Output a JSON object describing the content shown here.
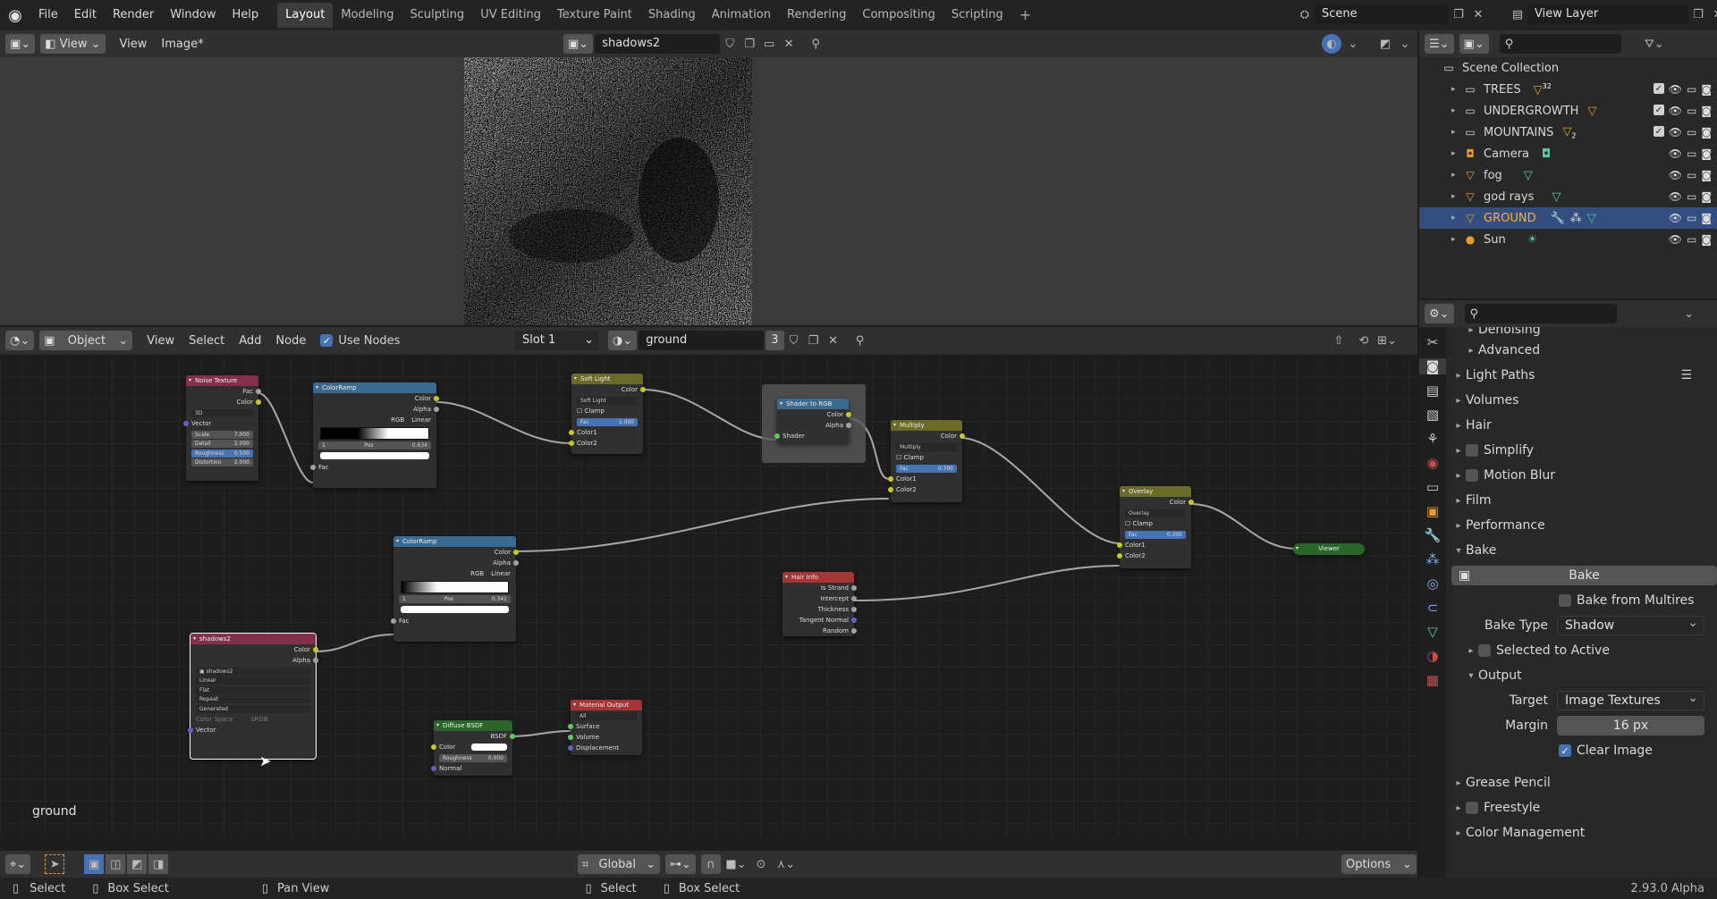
{
  "topbar": {
    "menus": [
      "File",
      "Edit",
      "Render",
      "Window",
      "Help"
    ],
    "workspaces": [
      "Layout",
      "Modeling",
      "Sculpting",
      "UV Editing",
      "Texture Paint",
      "Shading",
      "Animation",
      "Rendering",
      "Compositing",
      "Scripting"
    ],
    "active_workspace": "Layout",
    "scene": "Scene",
    "view_layer": "View Layer"
  },
  "image_editor": {
    "view_label": "View",
    "view_menu": "View",
    "image_menu": "Image*",
    "image_name": "shadows2"
  },
  "node_editor": {
    "object_mode": "Object",
    "menus": [
      "View",
      "Select",
      "Add",
      "Node"
    ],
    "use_nodes_label": "Use Nodes",
    "slot": "Slot 1",
    "material": "ground",
    "users": "3",
    "overlay_label": "ground",
    "footer": {
      "transform": "Global",
      "options": "Options"
    },
    "nodes": {
      "noise": {
        "title": "Noise Texture",
        "out_fac": "Fac",
        "out_color": "Color",
        "dim": "3D",
        "vector": "Vector",
        "scale_l": "Scale",
        "scale_v": "7.000",
        "detail_l": "Detail",
        "detail_v": "2.000",
        "rough_l": "Roughness",
        "rough_v": "0.500",
        "dist_l": "Distortion",
        "dist_v": "2.000"
      },
      "ramp1": {
        "title": "ColorRamp",
        "out_color": "Color",
        "out_alpha": "Alpha",
        "mode": "RGB",
        "interp": "Linear",
        "idx": "1",
        "pos_l": "Pos",
        "pos_v": "0.634",
        "fac": "Fac"
      },
      "softlight": {
        "title": "Soft Light",
        "out_color": "Color",
        "blend": "Soft Light",
        "clamp": "Clamp",
        "fac_l": "Fac",
        "fac_v": "1.000",
        "c1": "Color1",
        "c2": "Color2"
      },
      "shader2rgb": {
        "title": "Shader to RGB",
        "out_color": "Color",
        "out_alpha": "Alpha",
        "shader": "Shader"
      },
      "multiply": {
        "title": "Multiply",
        "out_color": "Color",
        "blend": "Multiply",
        "clamp": "Clamp",
        "fac_l": "Fac",
        "fac_v": "0.700",
        "c1": "Color1",
        "c2": "Color2"
      },
      "overlay": {
        "title": "Overlay",
        "out_color": "Color",
        "blend": "Overlay",
        "clamp": "Clamp",
        "fac_l": "Fac",
        "fac_v": "0.300",
        "c1": "Color1",
        "c2": "Color2"
      },
      "viewer": {
        "title": "Viewer"
      },
      "ramp2": {
        "title": "ColorRamp",
        "out_color": "Color",
        "out_alpha": "Alpha",
        "mode": "RGB",
        "interp": "Linear",
        "idx": "1",
        "pos_l": "Pos",
        "pos_v": "0.341",
        "fac": "Fac"
      },
      "hairinfo": {
        "title": "Hair Info",
        "o1": "Is Strand",
        "o2": "Intercept",
        "o3": "Thickness",
        "o4": "Tangent Normal",
        "o5": "Random"
      },
      "imgtex": {
        "title": "shadows2",
        "out_color": "Color",
        "out_alpha": "Alpha",
        "img": "shadows2",
        "interp": "Linear",
        "proj": "Flat",
        "ext": "Repeat",
        "src": "Generated",
        "cs_l": "Color Space",
        "cs_v": "sRGB",
        "vector": "Vector"
      },
      "diffuse": {
        "title": "Diffuse BSDF",
        "out": "BSDF",
        "color": "Color",
        "rough_l": "Roughness",
        "rough_v": "0.000",
        "normal": "Normal"
      },
      "matout": {
        "title": "Material Output",
        "target": "All",
        "surface": "Surface",
        "volume": "Volume",
        "disp": "Displacement"
      }
    }
  },
  "outliner": {
    "root": "Scene Collection",
    "items": [
      {
        "name": "TREES",
        "badge": "32"
      },
      {
        "name": "UNDERGROWTH",
        "badge": ""
      },
      {
        "name": "MOUNTAINS",
        "badge": "2"
      },
      {
        "name": "Camera",
        "badge": ""
      },
      {
        "name": "fog",
        "badge": ""
      },
      {
        "name": "god rays",
        "badge": ""
      },
      {
        "name": "GROUND",
        "badge": ""
      },
      {
        "name": "Sun",
        "badge": ""
      }
    ]
  },
  "properties": {
    "sections": {
      "denoising": "Denoising",
      "advanced": "Advanced",
      "light_paths": "Light Paths",
      "volumes": "Volumes",
      "hair": "Hair",
      "simplify": "Simplify",
      "motion_blur": "Motion Blur",
      "film": "Film",
      "performance": "Performance",
      "bake": "Bake",
      "grease_pencil": "Grease Pencil",
      "freestyle": "Freestyle",
      "color_management": "Color Management"
    },
    "bake_button": "Bake",
    "bake_from_multires": "Bake from Multires",
    "bake_type_label": "Bake Type",
    "bake_type_value": "Shadow",
    "selected_to_active": "Selected to Active",
    "output": "Output",
    "target_label": "Target",
    "target_value": "Image Textures",
    "margin_label": "Margin",
    "margin_value": "16 px",
    "clear_image": "Clear Image"
  },
  "statusbar": {
    "select": "Select",
    "box_select": "Box Select",
    "pan_view": "Pan View",
    "select2": "Select",
    "box_select2": "Box Select",
    "version": "2.93.0 Alpha"
  },
  "colors": {
    "accent": "#4772b3",
    "selected_row": "#334d80"
  }
}
